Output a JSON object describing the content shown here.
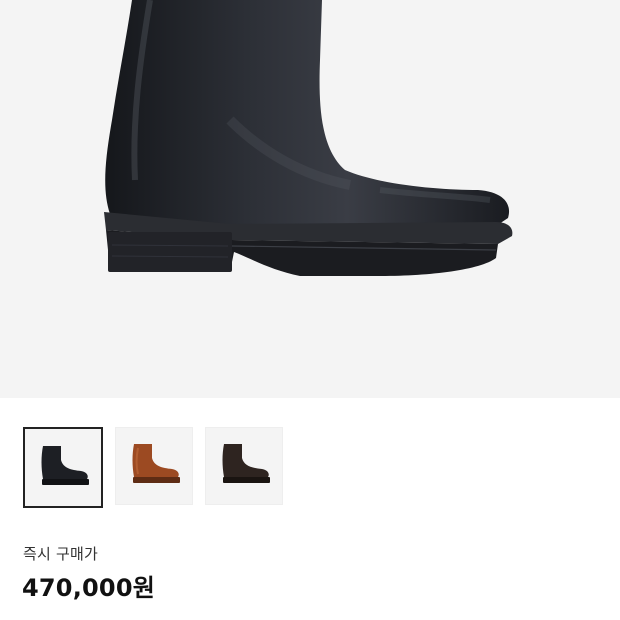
{
  "hero": {
    "image": "black-leather-boot-photo"
  },
  "thumbnails": [
    {
      "image": "black-boot-thumbnail",
      "color": "#1d1f24",
      "selected": true
    },
    {
      "image": "brown-boot-thumbnail",
      "color": "#9c4a22",
      "selected": false
    },
    {
      "image": "dark-brown-boot-thumbnail",
      "color": "#2e2420",
      "selected": false
    }
  ],
  "price": {
    "label": "즉시 구매가",
    "value": "470,000원"
  }
}
